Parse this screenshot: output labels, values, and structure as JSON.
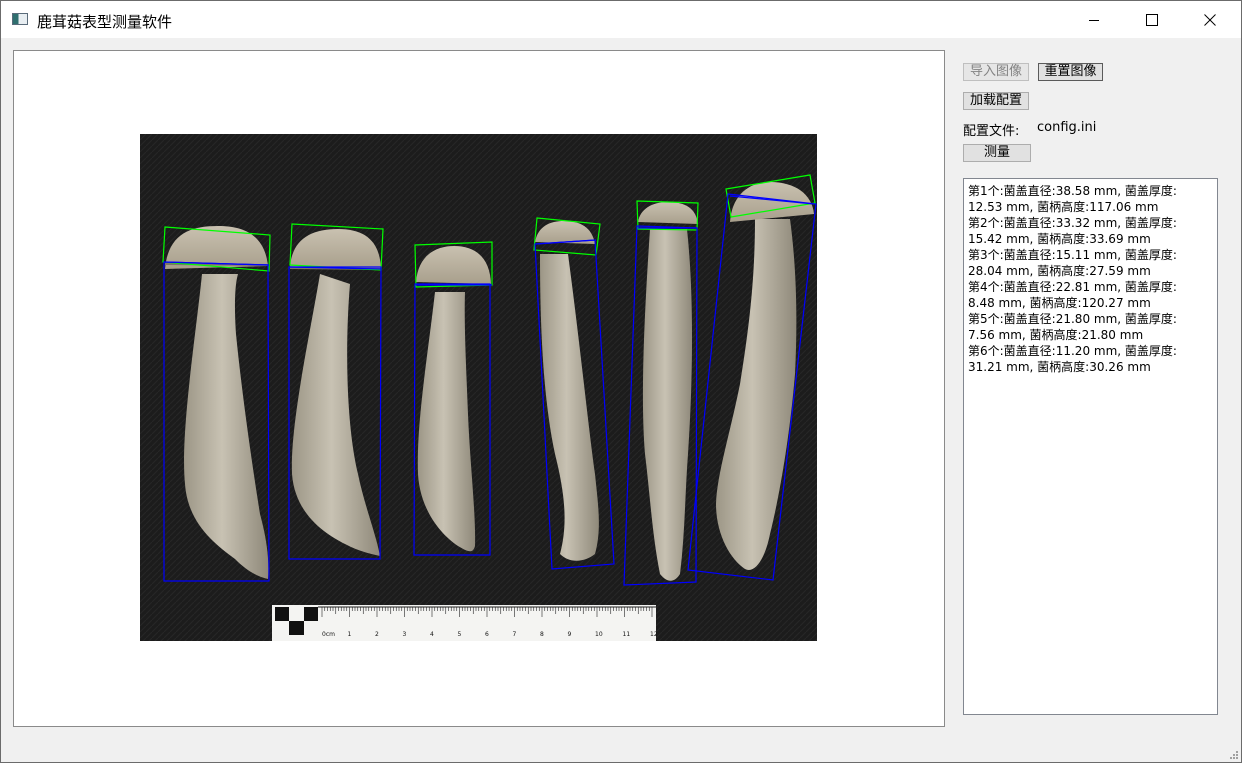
{
  "window": {
    "title": "鹿茸菇表型测量软件"
  },
  "toolbar": {
    "import_label": "导入图像",
    "reset_label": "重置图像",
    "load_config_label": "加载配置",
    "config_file_label": "配置文件:",
    "config_file_value": "config.ini",
    "measure_label": "测量"
  },
  "results": [
    "第1个:菌盖直径:38.58 mm, 菌盖厚度:",
    "12.53 mm, 菌柄高度:117.06 mm",
    "第2个:菌盖直径:33.32 mm, 菌盖厚度:",
    "15.42 mm, 菌柄高度:33.69 mm",
    "第3个:菌盖直径:15.11 mm, 菌盖厚度:",
    "28.04 mm, 菌柄高度:27.59 mm",
    "第4个:菌盖直径:22.81 mm, 菌盖厚度:",
    "8.48 mm, 菌柄高度:120.27 mm",
    "第5个:菌盖直径:21.80 mm, 菌盖厚度:",
    "7.56 mm, 菌柄高度:21.80 mm",
    "第6个:菌盖直径:11.20 mm, 菌盖厚度:",
    "31.21 mm, 菌柄高度:30.26 mm"
  ],
  "ruler": {
    "unit_label": "0cm",
    "ticks": [
      "1",
      "2",
      "3",
      "4",
      "5",
      "6",
      "7",
      "8",
      "9",
      "10",
      "11",
      "12"
    ]
  },
  "colors": {
    "cap_box": "#00ff00",
    "stem_box": "#0000ff",
    "background_mat": "#1b1b1b"
  }
}
